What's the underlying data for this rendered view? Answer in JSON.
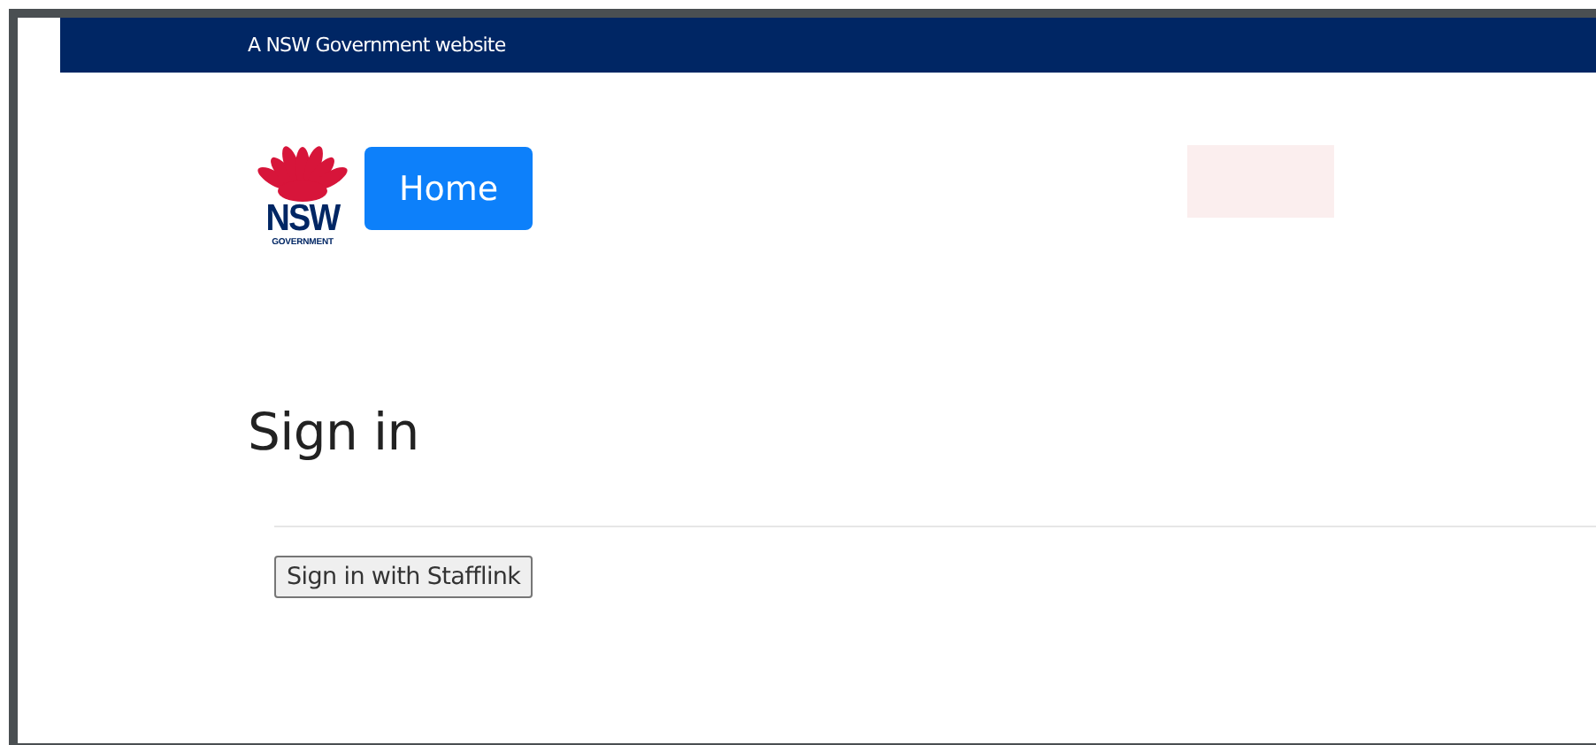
{
  "masthead": {
    "text": "A NSW Government website"
  },
  "header": {
    "logo": {
      "wordmark": "NSW",
      "subtitle": "GOVERNMENT"
    },
    "home_button": "Home"
  },
  "main": {
    "heading": "Sign in",
    "sign_in_button": "Sign in with Stafflink"
  }
}
